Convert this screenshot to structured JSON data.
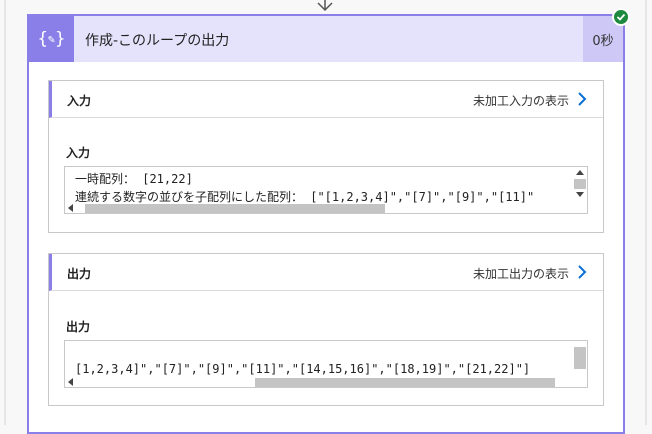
{
  "card": {
    "title": "作成-このループの出力",
    "duration": "0秒",
    "icon": "compose-braces-icon",
    "status_icon": "success-check-icon",
    "accent": "#8a7fe8",
    "header_bg": "#e5e2fb"
  },
  "inputs": {
    "header": "入力",
    "show_raw_link": "未加工入力の表示",
    "field_label": "入力",
    "lines": [
      "一時配列：  [21,22]",
      "連続する数字の並びを子配列にした配列：  [\"[1,2,3,4]\",\"[7]\",\"[9]\",\"[11]\""
    ]
  },
  "outputs": {
    "header": "出力",
    "show_raw_link": "未加工出力の表示",
    "field_label": "出力",
    "lines": [
      "[1,2,3,4]\",\"[7]\",\"[9]\",\"[11]\",\"[14,15,16]\",\"[18,19]\",\"[21,22]\"]"
    ]
  }
}
